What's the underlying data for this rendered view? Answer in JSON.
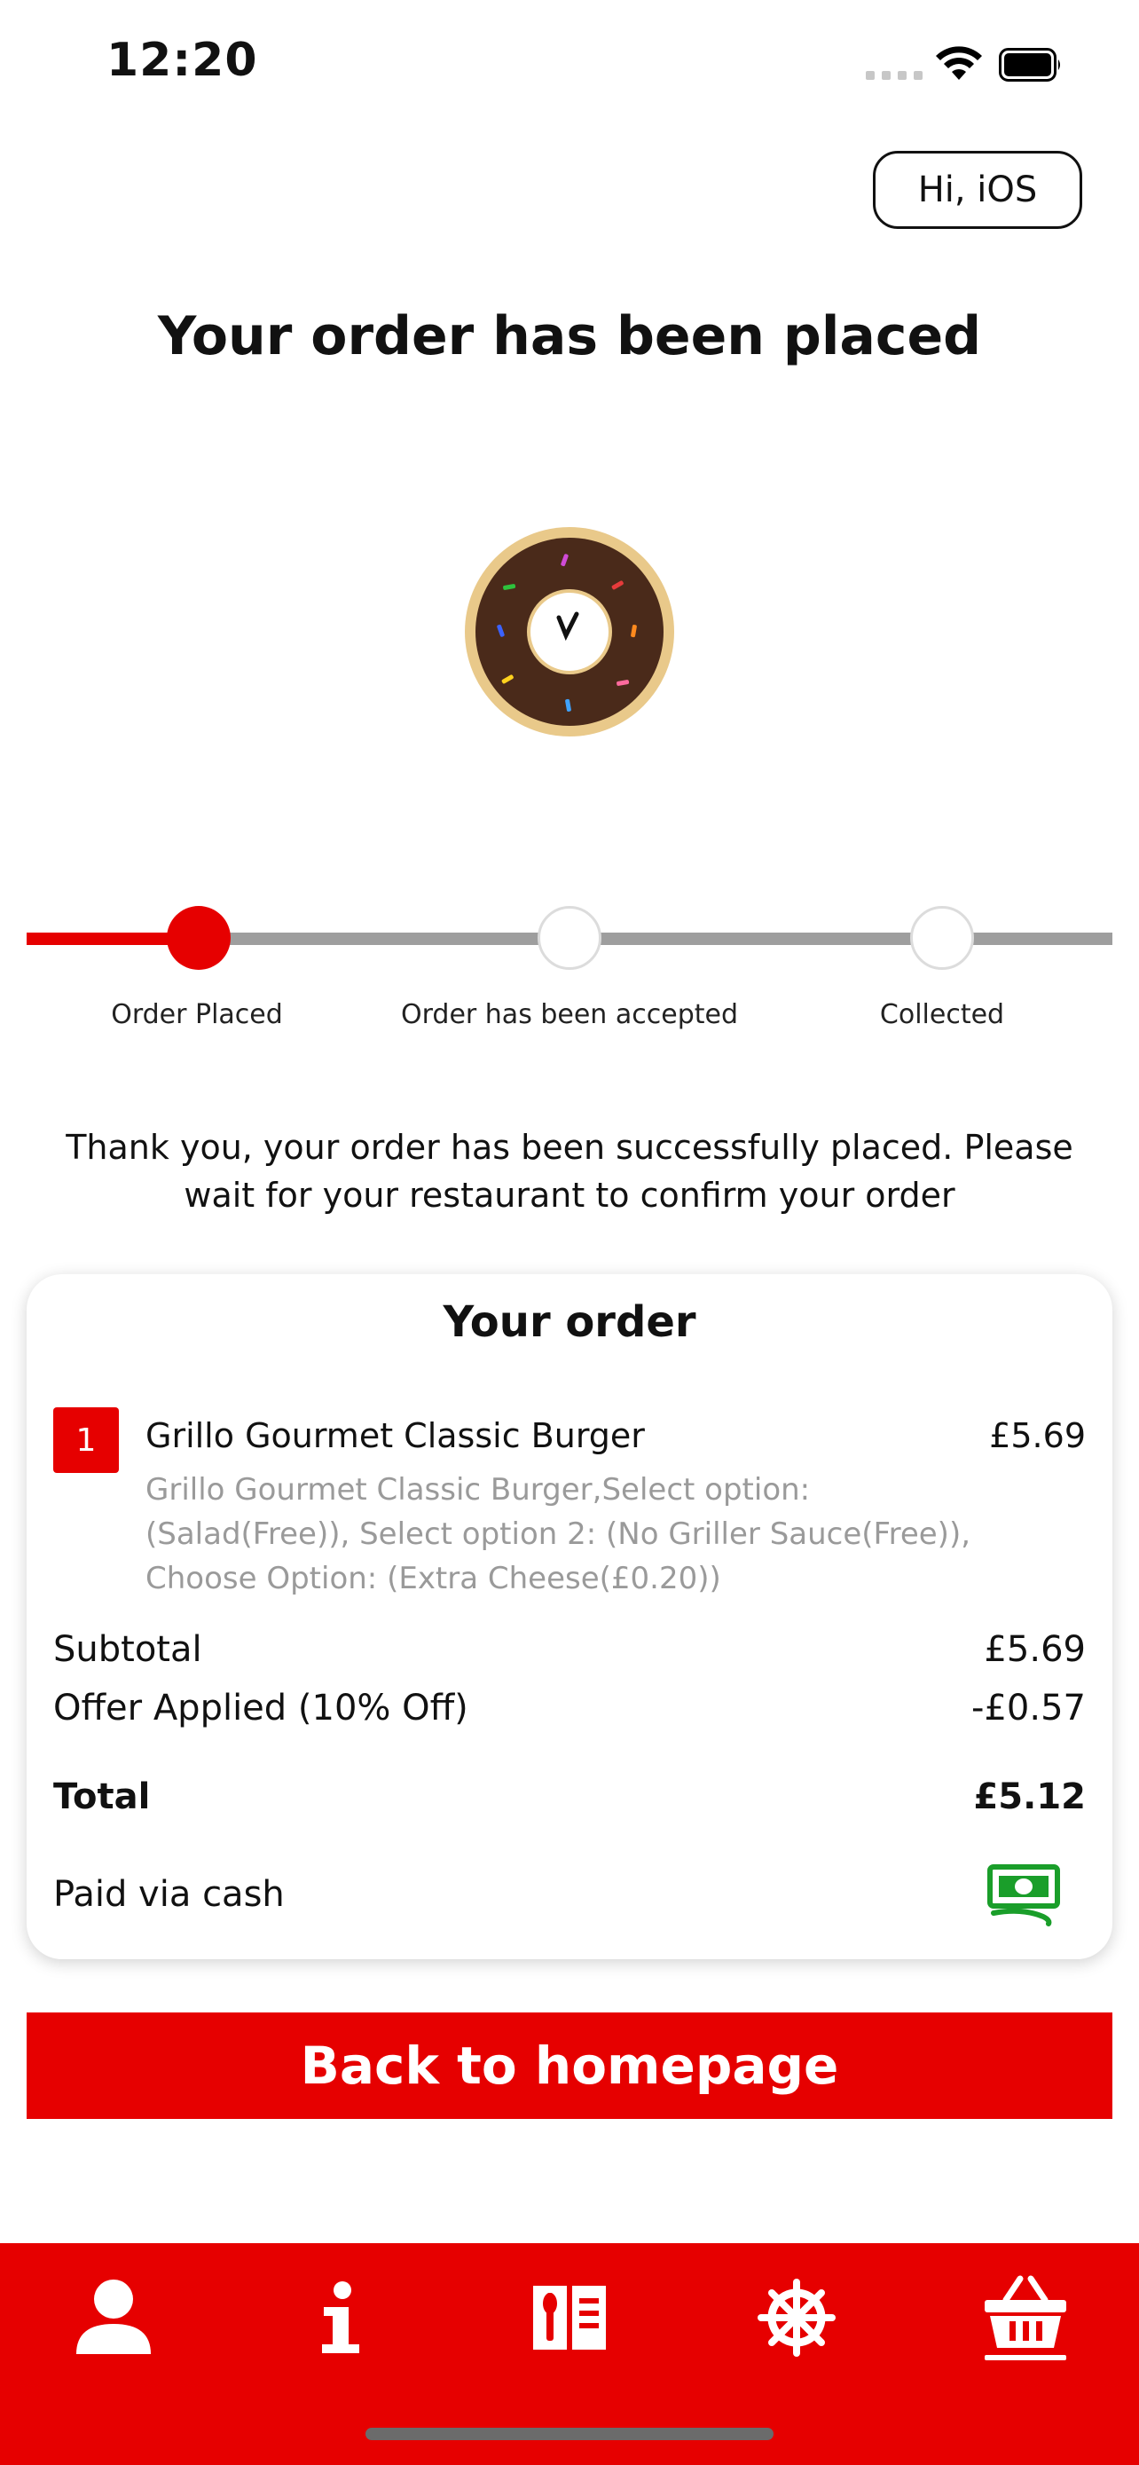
{
  "status_bar": {
    "time": "12:20"
  },
  "header": {
    "greeting": "Hi, iOS",
    "title": "Your order has been placed"
  },
  "progress": {
    "current_step": 1,
    "total_steps": 3,
    "steps": [
      {
        "label": "Order Placed"
      },
      {
        "label": "Order has been accepted"
      },
      {
        "label": "Collected"
      }
    ]
  },
  "message": "Thank you, your order has been successfully placed. Please wait for your restaurant to confirm your order",
  "order": {
    "title": "Your order",
    "items": [
      {
        "qty": "1",
        "name": "Grillo Gourmet Classic Burger",
        "price": "£5.69",
        "description": "Grillo Gourmet Classic Burger,Select option: (Salad(Free)), Select option 2: (No Griller Sauce(Free)), Choose Option: (Extra Cheese(£0.20))"
      }
    ],
    "subtotal_label": "Subtotal",
    "subtotal_value": "£5.69",
    "offer_label": "Offer Applied (10% Off)",
    "offer_value": "-£0.57",
    "total_label": "Total",
    "total_value": "£5.12",
    "payment_label": "Paid via cash"
  },
  "back_button": "Back to homepage",
  "nav": {
    "items": [
      {
        "icon": "person-icon"
      },
      {
        "icon": "info-icon"
      },
      {
        "icon": "menu-icon"
      },
      {
        "icon": "settings-wheel-icon"
      },
      {
        "icon": "basket-icon",
        "active": true
      }
    ]
  },
  "colors": {
    "accent": "#e60000",
    "track": "#9e9e9e",
    "cash": "#1a9e2a"
  }
}
